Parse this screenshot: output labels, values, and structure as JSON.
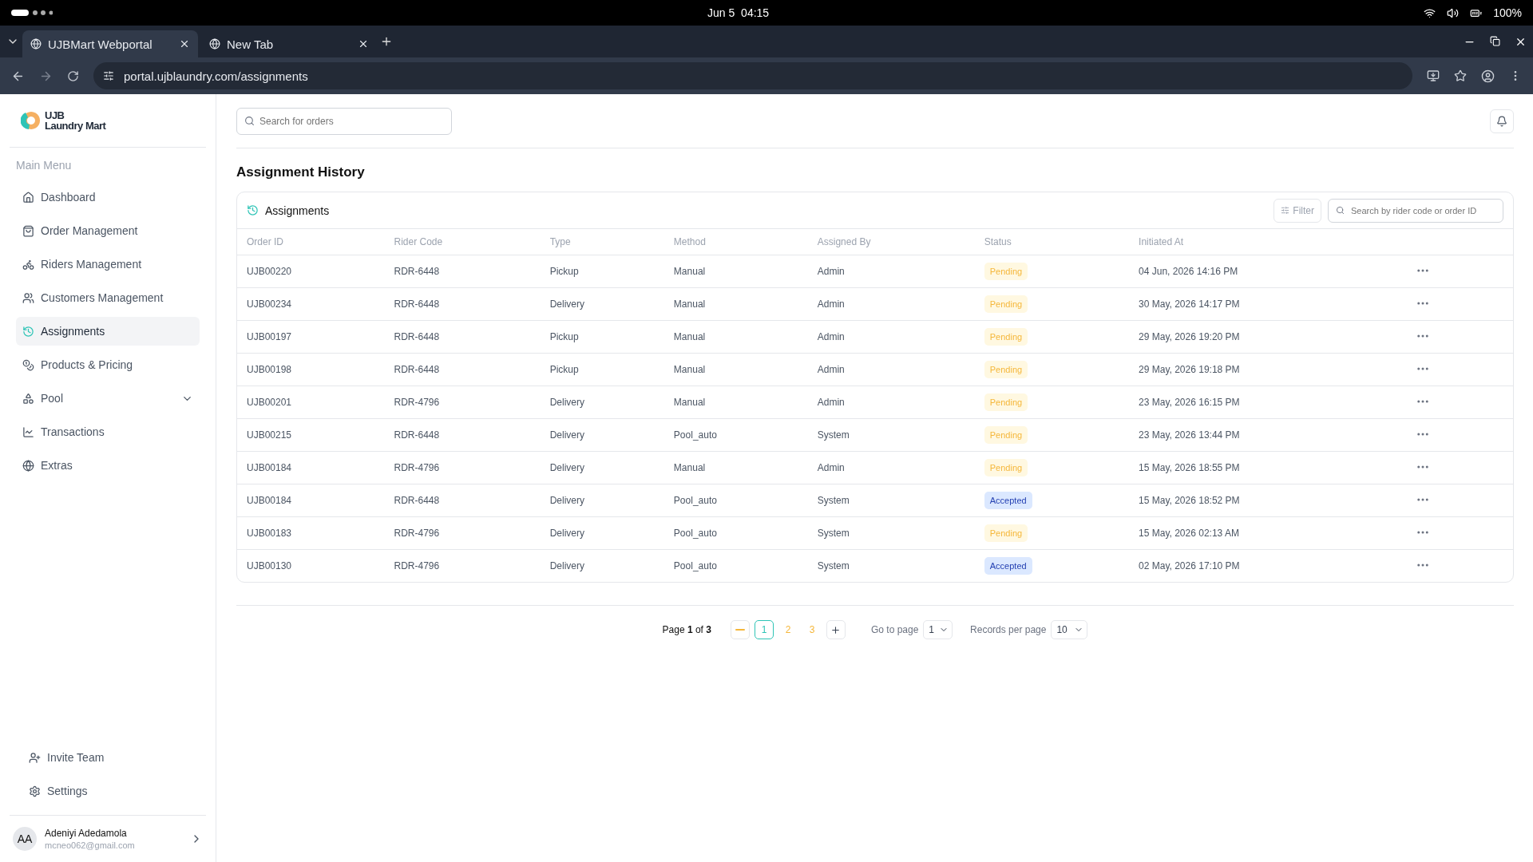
{
  "system_bar": {
    "clock": "Jun 5  04:15",
    "battery": "100%"
  },
  "browser": {
    "tabs": [
      {
        "label": "UJBMart Webportal",
        "selected": true
      },
      {
        "label": "New Tab",
        "selected": false
      }
    ],
    "url": "portal.ujblaundry.com/assignments"
  },
  "sidebar": {
    "logo": {
      "line_1": "UJB",
      "line_2": "Laundry Mart"
    },
    "section": "Main Menu",
    "items": [
      {
        "label": "Dashboard",
        "selected": false
      },
      {
        "label": "Order Management",
        "selected": false
      },
      {
        "label": "Riders Management",
        "selected": false
      },
      {
        "label": "Customers Management",
        "selected": false
      },
      {
        "label": "Assignments",
        "selected": true
      },
      {
        "label": "Products & Pricing",
        "selected": false
      },
      {
        "label": "Pool",
        "selected": false,
        "expandable": true
      },
      {
        "label": "Transactions",
        "selected": false
      },
      {
        "label": "Extras",
        "selected": false
      }
    ],
    "footer_items": [
      {
        "label": "Invite Team"
      },
      {
        "label": "Settings"
      }
    ],
    "user": {
      "initials": "AA",
      "name": "Adeniyi Adedamola",
      "email": "mcneo062@gmail.com"
    }
  },
  "topbar": {
    "search_placeholder": "Search for orders"
  },
  "page_title": "Assignment History",
  "card": {
    "title": "Assignments",
    "filter": "Filter",
    "search_placeholder": "Search by rider code or order ID"
  },
  "table": {
    "columns": [
      "Order ID",
      "Rider Code",
      "Type",
      "Method",
      "Assigned By",
      "Status",
      "Initiated At"
    ],
    "rows": [
      {
        "order_id": "UJB00220",
        "rider": "RDR-6448",
        "type": "Pickup",
        "method": "Manual",
        "by": "Admin",
        "status": "Pending",
        "kind": "pending",
        "at": "04 Jun, 2026 14:16 PM"
      },
      {
        "order_id": "UJB00234",
        "rider": "RDR-6448",
        "type": "Delivery",
        "method": "Manual",
        "by": "Admin",
        "status": "Pending",
        "kind": "pending",
        "at": "30 May, 2026 14:17 PM"
      },
      {
        "order_id": "UJB00197",
        "rider": "RDR-6448",
        "type": "Pickup",
        "method": "Manual",
        "by": "Admin",
        "status": "Pending",
        "kind": "pending",
        "at": "29 May, 2026 19:20 PM"
      },
      {
        "order_id": "UJB00198",
        "rider": "RDR-6448",
        "type": "Pickup",
        "method": "Manual",
        "by": "Admin",
        "status": "Pending",
        "kind": "pending",
        "at": "29 May, 2026 19:18 PM"
      },
      {
        "order_id": "UJB00201",
        "rider": "RDR-4796",
        "type": "Delivery",
        "method": "Manual",
        "by": "Admin",
        "status": "Pending",
        "kind": "pending",
        "at": "23 May, 2026 16:15 PM"
      },
      {
        "order_id": "UJB00215",
        "rider": "RDR-6448",
        "type": "Delivery",
        "method": "Pool_auto",
        "by": "System",
        "status": "Pending",
        "kind": "pending",
        "at": "23 May, 2026 13:44 PM"
      },
      {
        "order_id": "UJB00184",
        "rider": "RDR-4796",
        "type": "Delivery",
        "method": "Manual",
        "by": "Admin",
        "status": "Pending",
        "kind": "pending",
        "at": "15 May, 2026 18:55 PM"
      },
      {
        "order_id": "UJB00184",
        "rider": "RDR-6448",
        "type": "Delivery",
        "method": "Pool_auto",
        "by": "System",
        "status": "Accepted",
        "kind": "accepted",
        "at": "15 May, 2026 18:52 PM"
      },
      {
        "order_id": "UJB00183",
        "rider": "RDR-4796",
        "type": "Delivery",
        "method": "Pool_auto",
        "by": "System",
        "status": "Pending",
        "kind": "pending",
        "at": "15 May, 2026 02:13 AM"
      },
      {
        "order_id": "UJB00130",
        "rider": "RDR-4796",
        "type": "Delivery",
        "method": "Pool_auto",
        "by": "System",
        "status": "Accepted",
        "kind": "accepted",
        "at": "02 May, 2026 17:10 PM"
      }
    ]
  },
  "pagination": {
    "summary": "Page **1** of **3**",
    "pages": [
      {
        "label": "1",
        "selected": true
      },
      {
        "label": "2",
        "selected": false
      },
      {
        "label": "3",
        "selected": false
      }
    ],
    "go_to_label": "Go to page",
    "go_to_value": "1",
    "per_page_label": "Records per page",
    "per_page_value": "10"
  }
}
